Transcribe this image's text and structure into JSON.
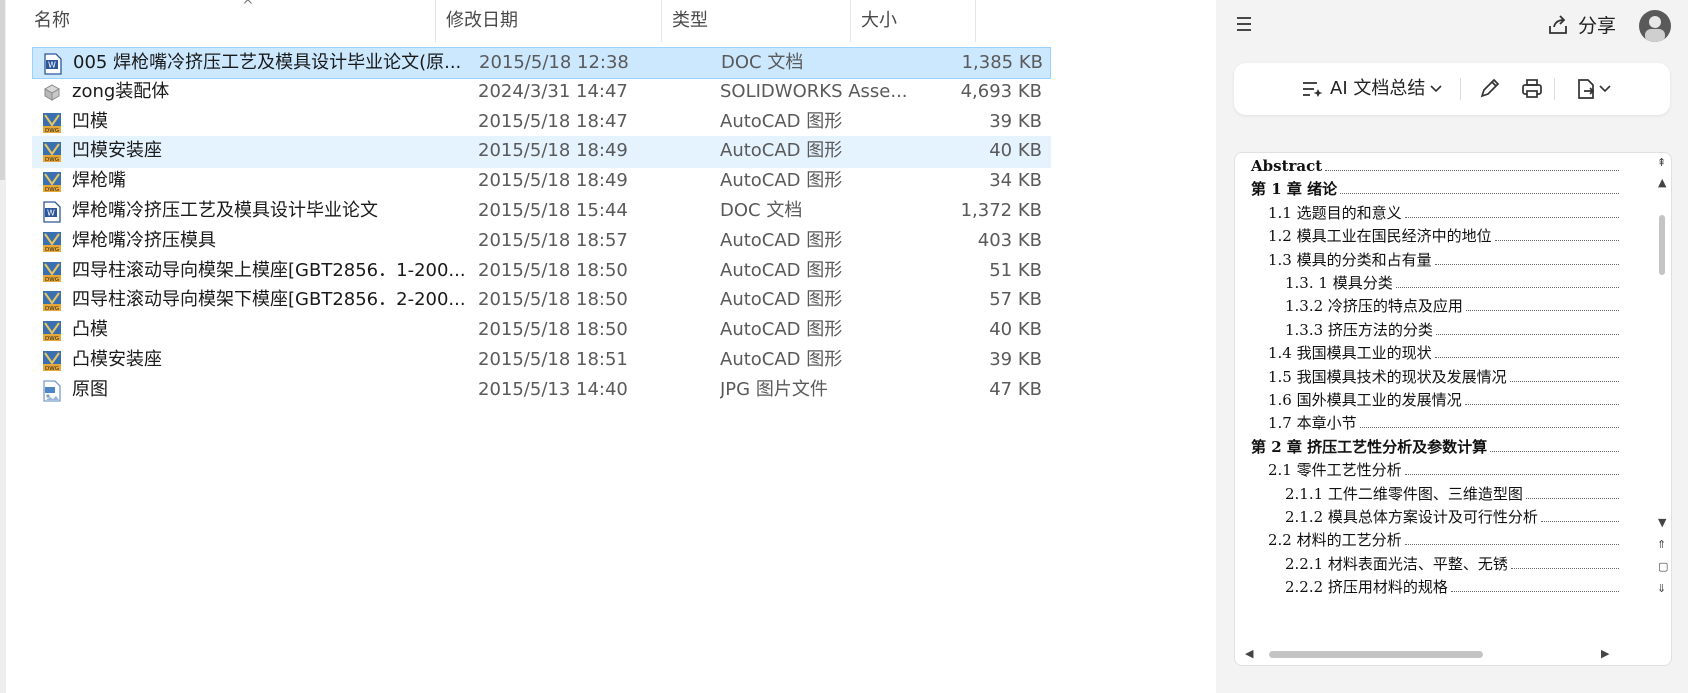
{
  "columns": {
    "name": "名称",
    "date": "修改日期",
    "type": "类型",
    "size": "大小"
  },
  "files": [
    {
      "name": "005 焊枪嘴冷挤压工艺及模具设计毕业论文(原...",
      "date": "2015/5/18 12:38",
      "type": "DOC 文档",
      "size": "1,385 KB",
      "icon": "word-doc-icon",
      "state": "selected"
    },
    {
      "name": "zong装配体",
      "date": "2024/3/31 14:47",
      "type": "SOLIDWORKS Asse...",
      "size": "4,693 KB",
      "icon": "solidworks-assembly-icon",
      "state": ""
    },
    {
      "name": "凹模",
      "date": "2015/5/18 18:47",
      "type": "AutoCAD 图形",
      "size": "39 KB",
      "icon": "autocad-dwg-icon",
      "state": ""
    },
    {
      "name": "凹模安装座",
      "date": "2015/5/18 18:49",
      "type": "AutoCAD 图形",
      "size": "40 KB",
      "icon": "autocad-dwg-icon",
      "state": "hover"
    },
    {
      "name": "焊枪嘴",
      "date": "2015/5/18 18:49",
      "type": "AutoCAD 图形",
      "size": "34 KB",
      "icon": "autocad-dwg-icon",
      "state": ""
    },
    {
      "name": "焊枪嘴冷挤压工艺及模具设计毕业论文",
      "date": "2015/5/18 15:44",
      "type": "DOC 文档",
      "size": "1,372 KB",
      "icon": "word-doc-icon",
      "state": ""
    },
    {
      "name": "焊枪嘴冷挤压模具",
      "date": "2015/5/18 18:57",
      "type": "AutoCAD 图形",
      "size": "403 KB",
      "icon": "autocad-dwg-icon",
      "state": ""
    },
    {
      "name": "四导柱滚动导向模架上模座[GBT2856．1-200...",
      "date": "2015/5/18 18:50",
      "type": "AutoCAD 图形",
      "size": "51 KB",
      "icon": "autocad-dwg-icon",
      "state": ""
    },
    {
      "name": "四导柱滚动导向模架下模座[GBT2856．2-200...",
      "date": "2015/5/18 18:50",
      "type": "AutoCAD 图形",
      "size": "57 KB",
      "icon": "autocad-dwg-icon",
      "state": ""
    },
    {
      "name": "凸模",
      "date": "2015/5/18 18:50",
      "type": "AutoCAD 图形",
      "size": "40 KB",
      "icon": "autocad-dwg-icon",
      "state": ""
    },
    {
      "name": "凸模安装座",
      "date": "2015/5/18 18:51",
      "type": "AutoCAD 图形",
      "size": "39 KB",
      "icon": "autocad-dwg-icon",
      "state": ""
    },
    {
      "name": "原图",
      "date": "2015/5/13 14:40",
      "type": "JPG 图片文件",
      "size": "47 KB",
      "icon": "jpg-image-icon",
      "state": ""
    }
  ],
  "panel": {
    "share_label": "分享",
    "ai_summary_label": "AI 文档总结",
    "icons": [
      "menu-icon",
      "share-icon",
      "avatar",
      "ai-summary-icon",
      "chevron-down-icon",
      "pen-icon",
      "print-icon",
      "export-icon"
    ]
  },
  "toc": [
    {
      "text": "Abstract",
      "level": 0
    },
    {
      "text": "第 1 章  绪论",
      "level": 0
    },
    {
      "text": "1.1    选题目的和意义",
      "level": 1
    },
    {
      "text": "1.2    模具工业在国民经济中的地位",
      "level": 1
    },
    {
      "text": "1.3    模具的分类和占有量",
      "level": 1
    },
    {
      "text": "1.3. 1    模具分类",
      "level": 2
    },
    {
      "text": "1.3.2    冷挤压的特点及应用",
      "level": 2
    },
    {
      "text": "1.3.3    挤压方法的分类",
      "level": 2
    },
    {
      "text": "1.4    我国模具工业的现状",
      "level": 1
    },
    {
      "text": "1.5    我国模具技术的现状及发展情况",
      "level": 1
    },
    {
      "text": "1.6    国外模具工业的发展情况",
      "level": 1
    },
    {
      "text": "1.7      本章小节",
      "level": 1
    },
    {
      "text": "第 2 章    挤压工艺性分析及参数计算",
      "level": 0
    },
    {
      "text": "2.1    零件工艺性分析",
      "level": 1
    },
    {
      "text": "2.1.1    工件二维零件图、三维造型图",
      "level": 2
    },
    {
      "text": "2.1.2    模具总体方案设计及可行性分析",
      "level": 2
    },
    {
      "text": "2.2    材料的工艺分析",
      "level": 1
    },
    {
      "text": "2.2.1    材料表面光洁、平整、无锈",
      "level": 2
    },
    {
      "text": "2.2.2    挤压用材料的规格",
      "level": 2
    }
  ]
}
